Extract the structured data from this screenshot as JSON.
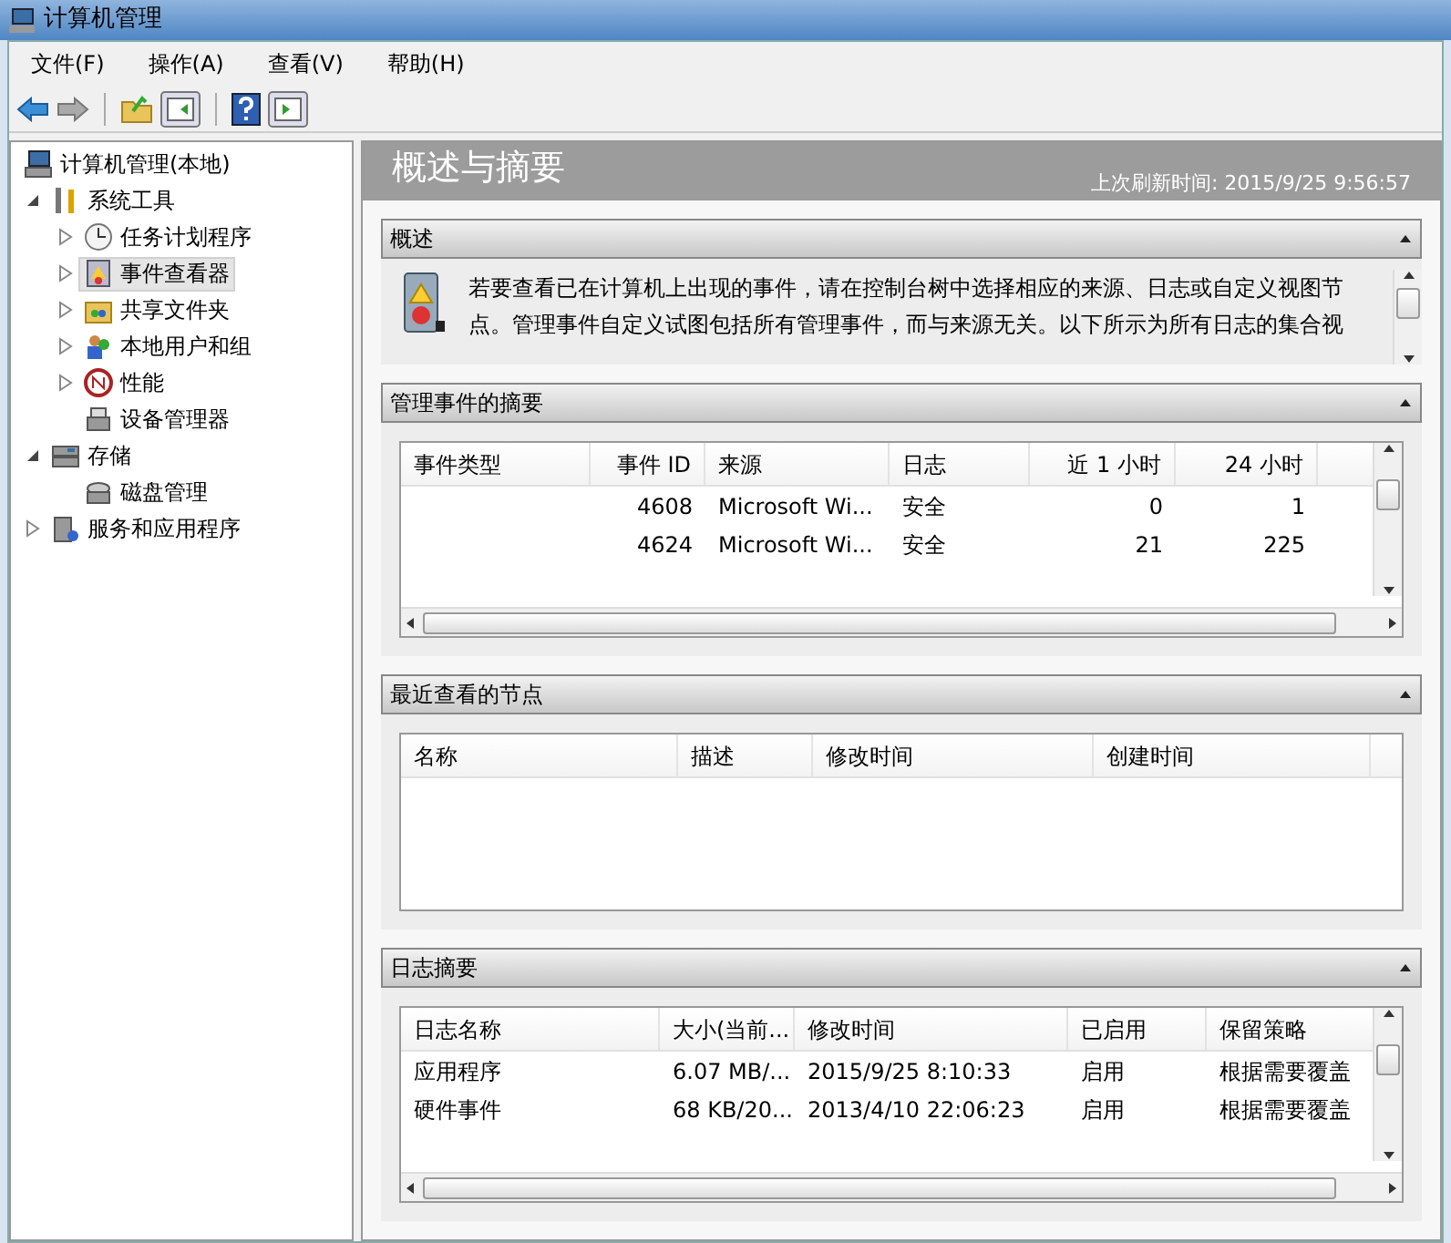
{
  "window": {
    "title": "计算机管理"
  },
  "menu": [
    "文件(F)",
    "操作(A)",
    "查看(V)",
    "帮助(H)"
  ],
  "tree": [
    {
      "label": "计算机管理(本地)",
      "selected": false,
      "children": [
        {
          "label": "系统工具",
          "expanded": true,
          "selected": false,
          "children": [
            {
              "label": "任务计划程序",
              "expanded": false,
              "selected": false
            },
            {
              "label": "事件查看器",
              "expanded": false,
              "selected": true
            },
            {
              "label": "共享文件夹",
              "expanded": false,
              "selected": false
            },
            {
              "label": "本地用户和组",
              "expanded": false,
              "selected": false
            },
            {
              "label": "性能",
              "expanded": false,
              "selected": false
            },
            {
              "label": "设备管理器",
              "selected": false
            }
          ]
        },
        {
          "label": "存储",
          "expanded": true,
          "selected": false,
          "children": [
            {
              "label": "磁盘管理",
              "selected": false
            }
          ]
        },
        {
          "label": "服务和应用程序",
          "expanded": false,
          "selected": false
        }
      ]
    }
  ],
  "header": {
    "title": "概述与摘要",
    "refresh": "上次刷新时间: 2015/9/25 9:56:57"
  },
  "sections": [
    {
      "kind": "text",
      "title": "概述",
      "text": "若要查看已在计算机上出现的事件，请在控制台树中选择相应的来源、日志或自定义视图节点。管理事件自定义试图包括所有管理事件，而与来源无关。以下所示为所有日志的集合视"
    },
    {
      "kind": "table",
      "title": "管理事件的摘要",
      "columns": [
        "事件类型",
        "事件 ID",
        "来源",
        "日志",
        "近 1 小时",
        "24 小时"
      ],
      "rows": [
        [
          "",
          "4608",
          "Microsoft Wi...",
          "安全",
          "0",
          "1"
        ],
        [
          "",
          "4624",
          "Microsoft Wi...",
          "安全",
          "21",
          "225"
        ]
      ]
    },
    {
      "kind": "table",
      "title": "最近查看的节点",
      "columns": [
        "名称",
        "描述",
        "修改时间",
        "创建时间"
      ]
    },
    {
      "kind": "table",
      "title": "日志摘要",
      "columns": [
        "日志名称",
        "大小(当前...",
        "修改时间",
        "已启用",
        "保留策略"
      ],
      "rows": [
        [
          "应用程序",
          "6.07 MB/...",
          "2015/9/25 8:10:33",
          "启用",
          "根据需要覆盖"
        ],
        [
          "硬件事件",
          "68 KB/20...",
          "2013/4/10 22:06:23",
          "启用",
          "根据需要覆盖"
        ]
      ]
    }
  ]
}
